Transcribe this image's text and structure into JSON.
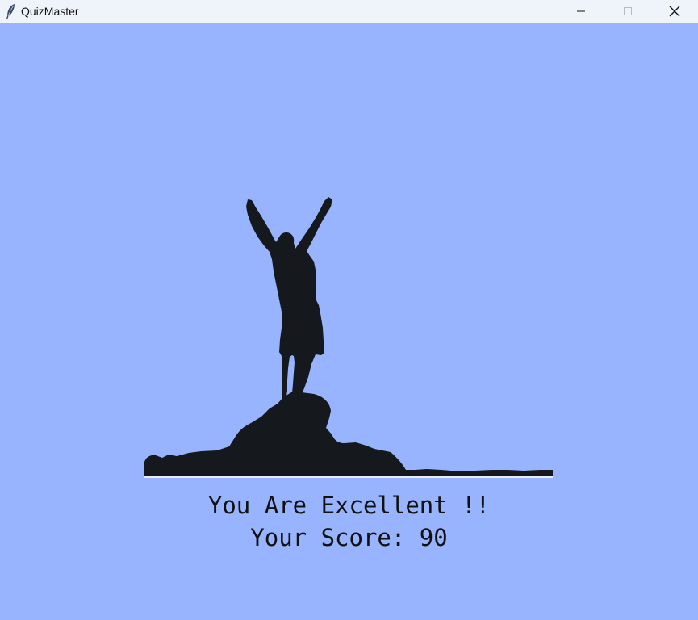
{
  "window": {
    "title": "QuizMaster",
    "icon": "feather-icon",
    "controls": [
      "minimize-icon",
      "maximize-icon",
      "close-icon"
    ]
  },
  "result": {
    "message": "You Are Excellent !!",
    "score_text": "Your Score: 90",
    "score": 90
  },
  "colors": {
    "background": "#98b4fe",
    "titlebar": "#eef4f9",
    "silhouette": "#15181d",
    "text": "#111111"
  },
  "image": {
    "subject": "silhouette-person-arms-raised-on-mountain"
  }
}
